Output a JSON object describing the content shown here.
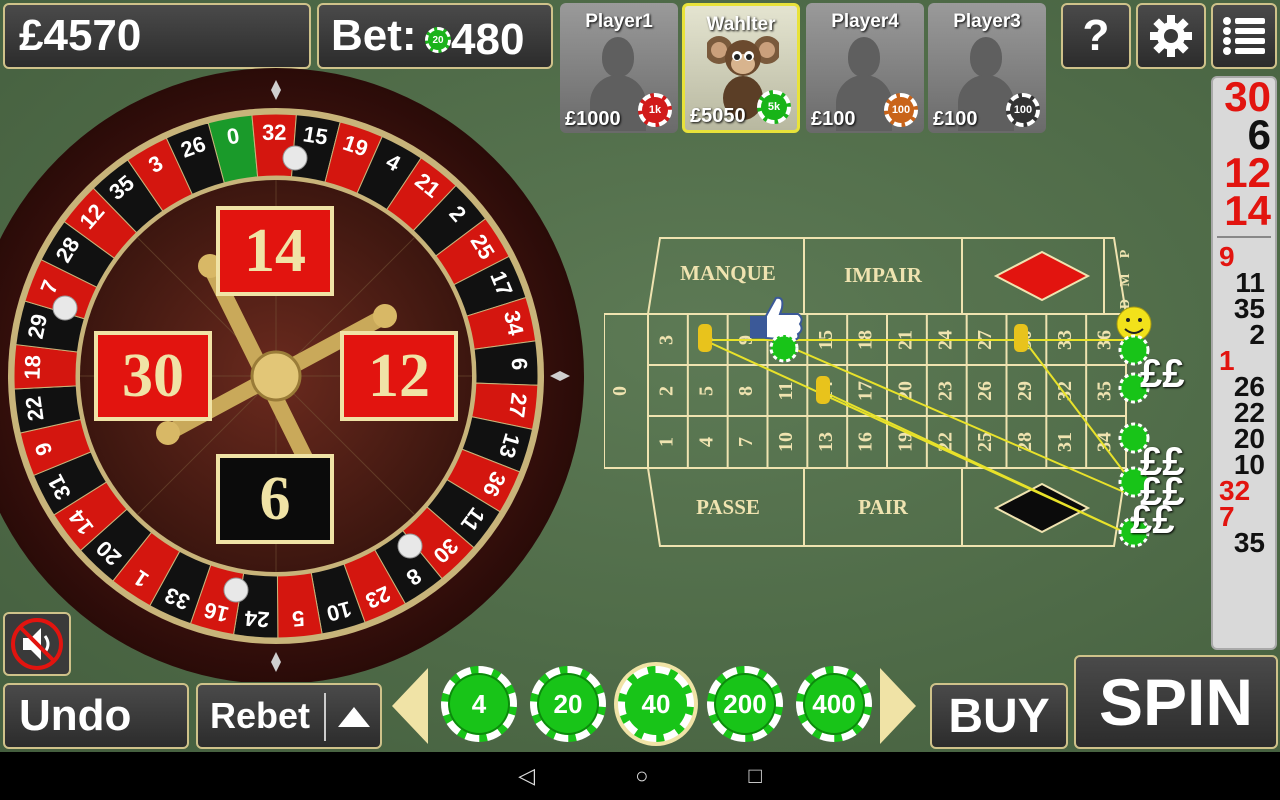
{
  "top": {
    "balance": "£4570",
    "bet_label": "Bet:",
    "bet_value": "480",
    "bet_chip": "20"
  },
  "players": [
    {
      "name": "Player1",
      "money": "£1000",
      "chip": "1k",
      "chip_color": "#d11a1a"
    },
    {
      "name": "Wahlter",
      "money": "£5050",
      "chip": "5k",
      "chip_color": "#18b418",
      "active": true
    },
    {
      "name": "Player4",
      "money": "£100",
      "chip": "100",
      "chip_color": "#c9641a"
    },
    {
      "name": "Player3",
      "money": "£100",
      "chip": "100",
      "chip_color": "#333333"
    }
  ],
  "icons": {
    "help": "?",
    "settings": "gear-icon",
    "menu": "menu-icon"
  },
  "wheel_results": [
    {
      "value": "14",
      "color": "red"
    },
    {
      "value": "30",
      "color": "red"
    },
    {
      "value": "12",
      "color": "red"
    },
    {
      "value": "6",
      "color": "black"
    }
  ],
  "wheel_numbers": [
    "0",
    "32",
    "15",
    "19",
    "4",
    "21",
    "2",
    "25",
    "17",
    "34",
    "6",
    "27",
    "13",
    "36",
    "11",
    "30",
    "8",
    "23",
    "10",
    "5",
    "24",
    "16",
    "33",
    "1",
    "20",
    "14",
    "31",
    "9",
    "22",
    "18",
    "29",
    "7",
    "28",
    "12",
    "35",
    "3",
    "26"
  ],
  "history": {
    "recent": [
      {
        "value": "30",
        "color": "red"
      },
      {
        "value": "6",
        "color": "black"
      },
      {
        "value": "12",
        "color": "red"
      },
      {
        "value": "14",
        "color": "red"
      }
    ],
    "older": [
      {
        "value": "9",
        "color": "red",
        "align": "left"
      },
      {
        "value": "11",
        "color": "black"
      },
      {
        "value": "35",
        "color": "black"
      },
      {
        "value": "2",
        "color": "black"
      },
      {
        "value": "1",
        "color": "red",
        "align": "left"
      },
      {
        "value": "26",
        "color": "black"
      },
      {
        "value": "22",
        "color": "black"
      },
      {
        "value": "20",
        "color": "black"
      },
      {
        "value": "10",
        "color": "black"
      },
      {
        "value": "32",
        "color": "red",
        "align": "left"
      },
      {
        "value": "7",
        "color": "red",
        "align": "left"
      },
      {
        "value": "35",
        "color": "black"
      }
    ]
  },
  "table": {
    "manque": "MANQUE",
    "impair": "IMPAIR",
    "passe": "PASSE",
    "pair": "PAIR",
    "zero": "0",
    "side_letters": [
      "P",
      "M",
      "D"
    ],
    "pound_signs": [
      "££",
      "££",
      "££",
      "££"
    ]
  },
  "chips": [
    "4",
    "20",
    "40",
    "200",
    "400"
  ],
  "selected_chip": "40",
  "buttons": {
    "undo": "Undo",
    "rebet": "Rebet",
    "buy": "BUY",
    "spin": "SPIN"
  },
  "navbar": {
    "back": "◁",
    "home": "○",
    "recent": "□"
  }
}
